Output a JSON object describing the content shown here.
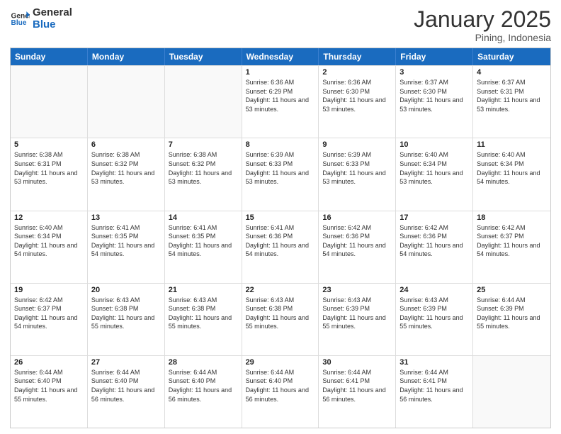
{
  "logo": {
    "text_general": "General",
    "text_blue": "Blue"
  },
  "header": {
    "month": "January 2025",
    "location": "Pining, Indonesia"
  },
  "weekdays": [
    "Sunday",
    "Monday",
    "Tuesday",
    "Wednesday",
    "Thursday",
    "Friday",
    "Saturday"
  ],
  "weeks": [
    [
      {
        "day": "",
        "sunrise": "",
        "sunset": "",
        "daylight": "",
        "empty": true
      },
      {
        "day": "",
        "sunrise": "",
        "sunset": "",
        "daylight": "",
        "empty": true
      },
      {
        "day": "",
        "sunrise": "",
        "sunset": "",
        "daylight": "",
        "empty": true
      },
      {
        "day": "1",
        "sunrise": "Sunrise: 6:36 AM",
        "sunset": "Sunset: 6:29 PM",
        "daylight": "Daylight: 11 hours and 53 minutes.",
        "empty": false
      },
      {
        "day": "2",
        "sunrise": "Sunrise: 6:36 AM",
        "sunset": "Sunset: 6:30 PM",
        "daylight": "Daylight: 11 hours and 53 minutes.",
        "empty": false
      },
      {
        "day": "3",
        "sunrise": "Sunrise: 6:37 AM",
        "sunset": "Sunset: 6:30 PM",
        "daylight": "Daylight: 11 hours and 53 minutes.",
        "empty": false
      },
      {
        "day": "4",
        "sunrise": "Sunrise: 6:37 AM",
        "sunset": "Sunset: 6:31 PM",
        "daylight": "Daylight: 11 hours and 53 minutes.",
        "empty": false
      }
    ],
    [
      {
        "day": "5",
        "sunrise": "Sunrise: 6:38 AM",
        "sunset": "Sunset: 6:31 PM",
        "daylight": "Daylight: 11 hours and 53 minutes.",
        "empty": false
      },
      {
        "day": "6",
        "sunrise": "Sunrise: 6:38 AM",
        "sunset": "Sunset: 6:32 PM",
        "daylight": "Daylight: 11 hours and 53 minutes.",
        "empty": false
      },
      {
        "day": "7",
        "sunrise": "Sunrise: 6:38 AM",
        "sunset": "Sunset: 6:32 PM",
        "daylight": "Daylight: 11 hours and 53 minutes.",
        "empty": false
      },
      {
        "day": "8",
        "sunrise": "Sunrise: 6:39 AM",
        "sunset": "Sunset: 6:33 PM",
        "daylight": "Daylight: 11 hours and 53 minutes.",
        "empty": false
      },
      {
        "day": "9",
        "sunrise": "Sunrise: 6:39 AM",
        "sunset": "Sunset: 6:33 PM",
        "daylight": "Daylight: 11 hours and 53 minutes.",
        "empty": false
      },
      {
        "day": "10",
        "sunrise": "Sunrise: 6:40 AM",
        "sunset": "Sunset: 6:34 PM",
        "daylight": "Daylight: 11 hours and 53 minutes.",
        "empty": false
      },
      {
        "day": "11",
        "sunrise": "Sunrise: 6:40 AM",
        "sunset": "Sunset: 6:34 PM",
        "daylight": "Daylight: 11 hours and 54 minutes.",
        "empty": false
      }
    ],
    [
      {
        "day": "12",
        "sunrise": "Sunrise: 6:40 AM",
        "sunset": "Sunset: 6:34 PM",
        "daylight": "Daylight: 11 hours and 54 minutes.",
        "empty": false
      },
      {
        "day": "13",
        "sunrise": "Sunrise: 6:41 AM",
        "sunset": "Sunset: 6:35 PM",
        "daylight": "Daylight: 11 hours and 54 minutes.",
        "empty": false
      },
      {
        "day": "14",
        "sunrise": "Sunrise: 6:41 AM",
        "sunset": "Sunset: 6:35 PM",
        "daylight": "Daylight: 11 hours and 54 minutes.",
        "empty": false
      },
      {
        "day": "15",
        "sunrise": "Sunrise: 6:41 AM",
        "sunset": "Sunset: 6:36 PM",
        "daylight": "Daylight: 11 hours and 54 minutes.",
        "empty": false
      },
      {
        "day": "16",
        "sunrise": "Sunrise: 6:42 AM",
        "sunset": "Sunset: 6:36 PM",
        "daylight": "Daylight: 11 hours and 54 minutes.",
        "empty": false
      },
      {
        "day": "17",
        "sunrise": "Sunrise: 6:42 AM",
        "sunset": "Sunset: 6:36 PM",
        "daylight": "Daylight: 11 hours and 54 minutes.",
        "empty": false
      },
      {
        "day": "18",
        "sunrise": "Sunrise: 6:42 AM",
        "sunset": "Sunset: 6:37 PM",
        "daylight": "Daylight: 11 hours and 54 minutes.",
        "empty": false
      }
    ],
    [
      {
        "day": "19",
        "sunrise": "Sunrise: 6:42 AM",
        "sunset": "Sunset: 6:37 PM",
        "daylight": "Daylight: 11 hours and 54 minutes.",
        "empty": false
      },
      {
        "day": "20",
        "sunrise": "Sunrise: 6:43 AM",
        "sunset": "Sunset: 6:38 PM",
        "daylight": "Daylight: 11 hours and 55 minutes.",
        "empty": false
      },
      {
        "day": "21",
        "sunrise": "Sunrise: 6:43 AM",
        "sunset": "Sunset: 6:38 PM",
        "daylight": "Daylight: 11 hours and 55 minutes.",
        "empty": false
      },
      {
        "day": "22",
        "sunrise": "Sunrise: 6:43 AM",
        "sunset": "Sunset: 6:38 PM",
        "daylight": "Daylight: 11 hours and 55 minutes.",
        "empty": false
      },
      {
        "day": "23",
        "sunrise": "Sunrise: 6:43 AM",
        "sunset": "Sunset: 6:39 PM",
        "daylight": "Daylight: 11 hours and 55 minutes.",
        "empty": false
      },
      {
        "day": "24",
        "sunrise": "Sunrise: 6:43 AM",
        "sunset": "Sunset: 6:39 PM",
        "daylight": "Daylight: 11 hours and 55 minutes.",
        "empty": false
      },
      {
        "day": "25",
        "sunrise": "Sunrise: 6:44 AM",
        "sunset": "Sunset: 6:39 PM",
        "daylight": "Daylight: 11 hours and 55 minutes.",
        "empty": false
      }
    ],
    [
      {
        "day": "26",
        "sunrise": "Sunrise: 6:44 AM",
        "sunset": "Sunset: 6:40 PM",
        "daylight": "Daylight: 11 hours and 55 minutes.",
        "empty": false
      },
      {
        "day": "27",
        "sunrise": "Sunrise: 6:44 AM",
        "sunset": "Sunset: 6:40 PM",
        "daylight": "Daylight: 11 hours and 56 minutes.",
        "empty": false
      },
      {
        "day": "28",
        "sunrise": "Sunrise: 6:44 AM",
        "sunset": "Sunset: 6:40 PM",
        "daylight": "Daylight: 11 hours and 56 minutes.",
        "empty": false
      },
      {
        "day": "29",
        "sunrise": "Sunrise: 6:44 AM",
        "sunset": "Sunset: 6:40 PM",
        "daylight": "Daylight: 11 hours and 56 minutes.",
        "empty": false
      },
      {
        "day": "30",
        "sunrise": "Sunrise: 6:44 AM",
        "sunset": "Sunset: 6:41 PM",
        "daylight": "Daylight: 11 hours and 56 minutes.",
        "empty": false
      },
      {
        "day": "31",
        "sunrise": "Sunrise: 6:44 AM",
        "sunset": "Sunset: 6:41 PM",
        "daylight": "Daylight: 11 hours and 56 minutes.",
        "empty": false
      },
      {
        "day": "",
        "sunrise": "",
        "sunset": "",
        "daylight": "",
        "empty": true
      }
    ]
  ]
}
